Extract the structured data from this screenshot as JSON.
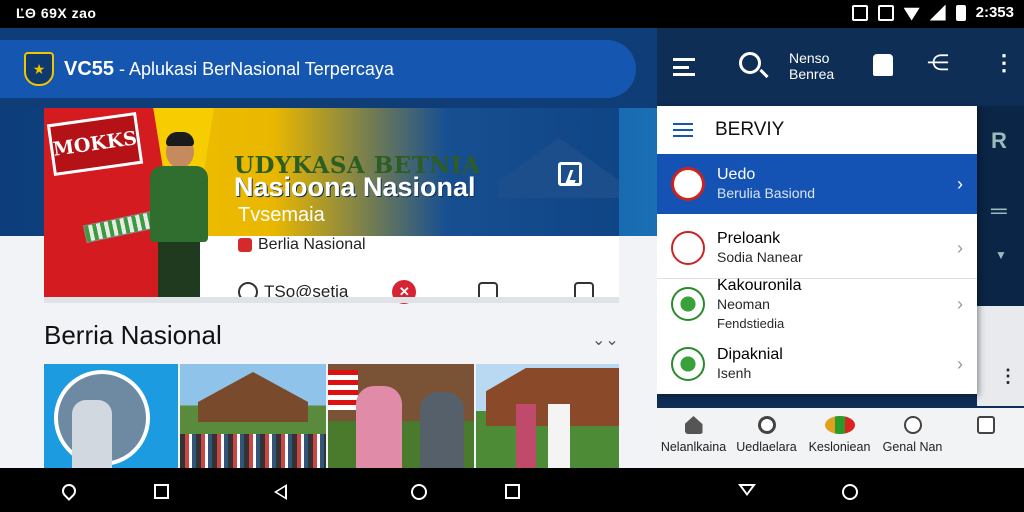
{
  "status_bar": {
    "left_text": "ĽΘ 69X zao",
    "time": "2:353"
  },
  "left_app": {
    "title_bold": "VC55",
    "title_rest": " - Aplukasi BerNasional Terpercaya",
    "banner": {
      "sign_text": "MOKKS",
      "headline_1": "UDYKASA BETNIA",
      "headline_2": "Nasioona Nasional",
      "headline_3": "Tvsemaia",
      "sub": "Berlia Nasional",
      "action_label": "TSo@setia"
    },
    "section_title": "Berria Nasional",
    "section_more": "⌄⌄"
  },
  "right_app": {
    "toolbar_title_line1": "Nenso",
    "toolbar_title_line2": "Benrea",
    "side_letter": "R",
    "drawer_title": "BERVIY",
    "items": [
      {
        "line1": "Uedo",
        "line2": "Berulia Basiond",
        "line3": ""
      },
      {
        "line1": "Preloank",
        "line2": "Sodia Nanear",
        "line3": ""
      },
      {
        "line1": "Kakouronila",
        "line2": "Neoman",
        "line3": "Fendstiedia"
      },
      {
        "line1": "Dipaknial",
        "line2": "Isenh",
        "line3": ""
      }
    ],
    "bottom_nav": [
      "Nelanlkaina",
      "Uedlaelara",
      "Kesloniean",
      "Genal Nan",
      ""
    ]
  },
  "icons": {
    "menu": "hamburger-icon",
    "search": "search-icon",
    "share": "share-icon",
    "more": "more-vert-icon"
  },
  "colors": {
    "primary": "#1557b0",
    "dark_bg": "#0e2e55",
    "accent_yellow": "#f2c500",
    "accent_red": "#d31b20"
  }
}
